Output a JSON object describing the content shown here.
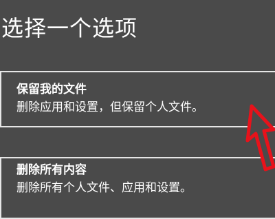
{
  "dialog": {
    "title": "选择一个选项"
  },
  "options": [
    {
      "heading": "保留我的文件",
      "description": "删除应用和设置，但保留个人文件。"
    },
    {
      "heading": "删除所有内容",
      "description": "删除所有个人文件、应用和设置。"
    }
  ],
  "annotation": {
    "icon": "red-arrow-cursor-icon",
    "color": "#e8121b"
  }
}
